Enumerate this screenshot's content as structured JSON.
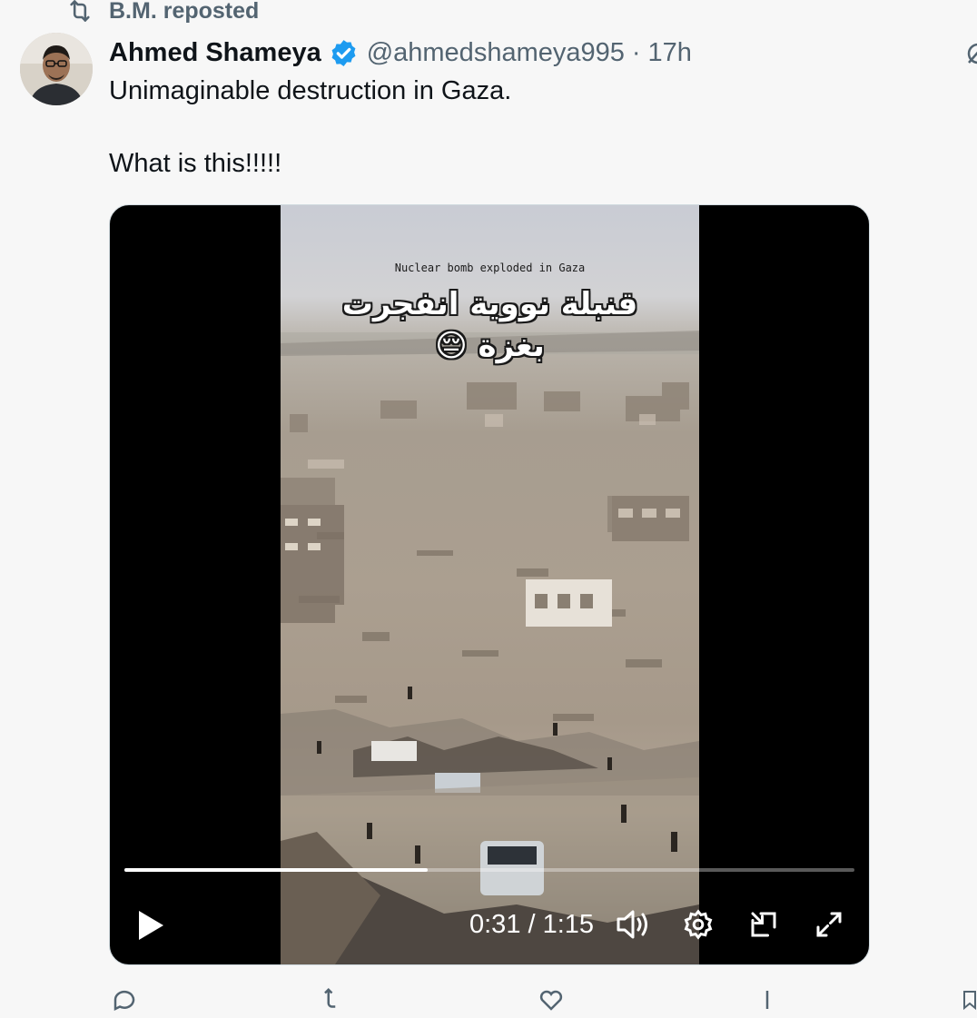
{
  "repost": {
    "label": "B.M. reposted",
    "icon": "repost-icon"
  },
  "author": {
    "name": "Ahmed Shameya",
    "handle": "@ahmedshameya995",
    "separator": "·",
    "time": "17h",
    "verified": true
  },
  "tweet": {
    "lines": [
      "Unimaginable destruction in Gaza.",
      "What is this!!!!!"
    ]
  },
  "video": {
    "caption_small": "Nuclear bomb exploded in Gaza",
    "caption_arabic": "قنبلة نووية انفجرت بغزة 😔",
    "time_display": "0:31 / 1:15",
    "progress": 0.415
  },
  "colors": {
    "accent": "#1d9bf0",
    "muted": "#536471",
    "background": "#f7f7f7"
  },
  "controls_icons": [
    "play-icon",
    "volume-icon",
    "settings-icon",
    "picture-in-picture-icon",
    "fullscreen-icon"
  ]
}
